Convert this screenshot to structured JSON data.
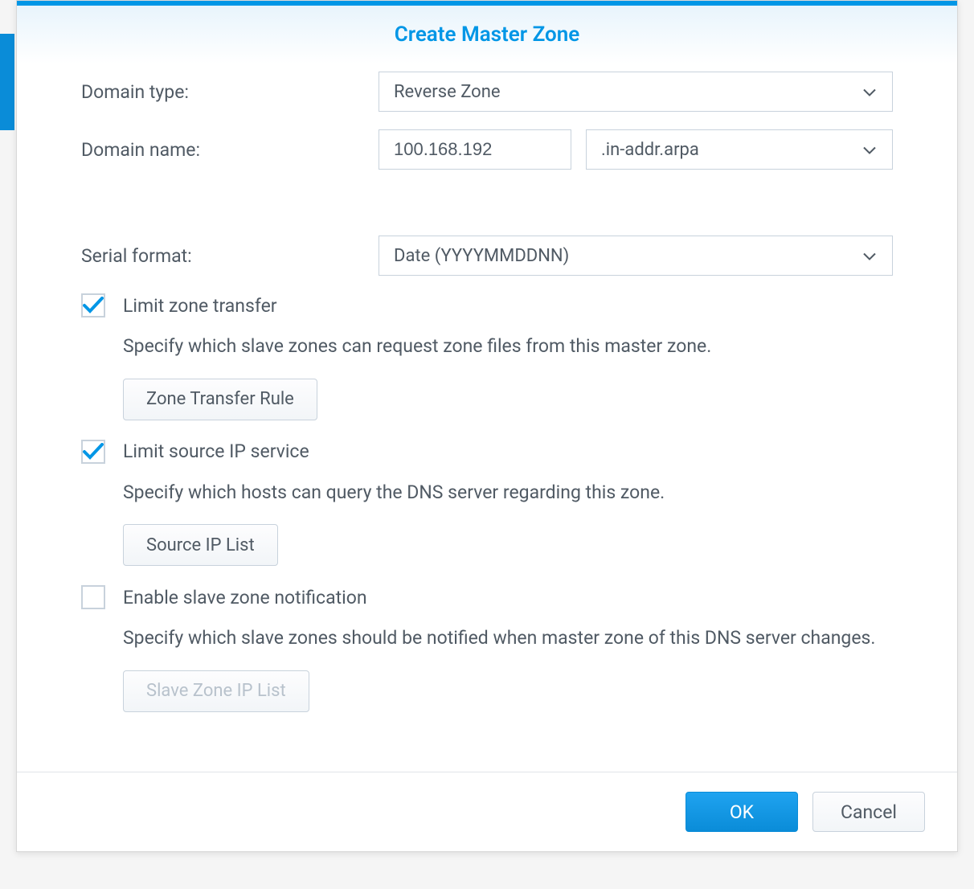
{
  "dialog": {
    "title": "Create Master Zone",
    "labels": {
      "domain_type": "Domain type:",
      "domain_name": "Domain name:",
      "serial_format": "Serial format:"
    },
    "domain_type": {
      "selected": "Reverse Zone"
    },
    "domain_name": {
      "value": "100.168.192",
      "suffix": ".in-addr.arpa"
    },
    "serial_format": {
      "selected": "Date (YYYYMMDDNN)"
    },
    "limit_zone_transfer": {
      "label": "Limit zone transfer",
      "checked": true,
      "help": "Specify which slave zones can request zone files from this master zone.",
      "button": "Zone Transfer Rule"
    },
    "limit_source_ip": {
      "label": "Limit source IP service",
      "checked": true,
      "help": "Specify which hosts can query the DNS server regarding this zone.",
      "button": "Source IP List"
    },
    "enable_slave_notification": {
      "label": "Enable slave zone notification",
      "checked": false,
      "help": "Specify which slave zones should be notified when master zone of this DNS server changes.",
      "button": "Slave Zone IP List"
    },
    "footer": {
      "ok": "OK",
      "cancel": "Cancel"
    }
  }
}
